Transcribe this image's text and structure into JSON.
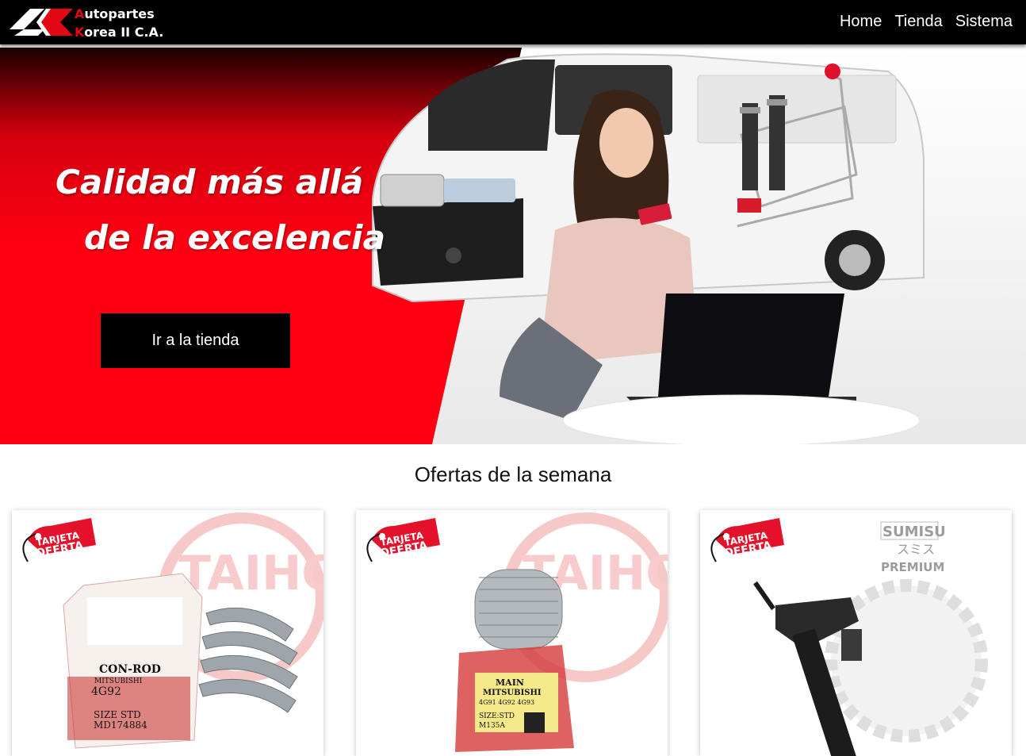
{
  "brand": {
    "line1_initial": "A",
    "line1_rest": "utopartes",
    "line2_initial": "K",
    "line2_rest": "orea II C.A."
  },
  "nav": {
    "items": [
      "Home",
      "Tienda",
      "Sistema"
    ]
  },
  "hero": {
    "title_line1": "Calidad más allá",
    "title_line2": "de la excelencia",
    "button_label": "Ir a la tienda",
    "accent_color": "#ff0013"
  },
  "offers": {
    "section_title": "Ofertas de la semana",
    "badge_line1": "TARJETA",
    "badge_line2": "OFERTA",
    "products": [
      {
        "box_brand": "TAIHO",
        "box_line1": "CON-ROD",
        "box_line2": "MITSUBISHI",
        "box_line3": "4G92",
        "box_size": "SIZE  STD",
        "box_code": "MD174884"
      },
      {
        "box_brand": "TAIHO",
        "box_line1": "MAIN",
        "box_line2": "MITSUBISHI",
        "box_line3": "4G91 4G92 4G93",
        "box_size": "SIZE:STD",
        "box_code": "M135A"
      },
      {
        "box_brand": "SUMISU",
        "box_line1": "スミス",
        "box_line2": "PREMIUM"
      }
    ]
  }
}
